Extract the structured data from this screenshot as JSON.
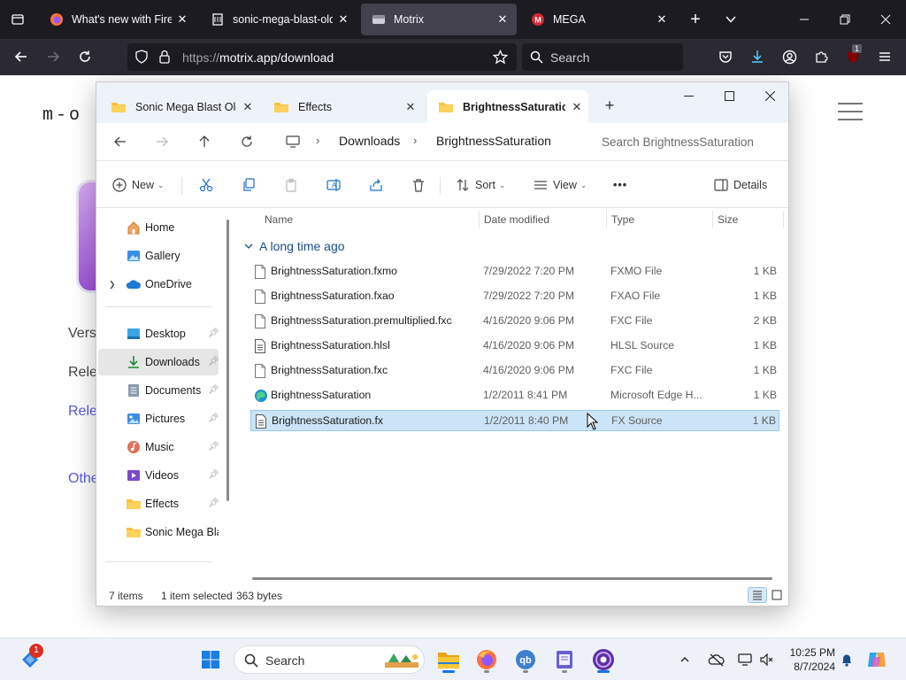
{
  "browser": {
    "tabs": [
      {
        "title": "What's new with Firefo",
        "icon": "firefox-icon"
      },
      {
        "title": "sonic-mega-blast-old-",
        "icon": "github-icon"
      },
      {
        "title": "Motrix",
        "icon": "motrix-icon",
        "active": true
      },
      {
        "title": "MEGA",
        "icon": "mega-icon"
      }
    ],
    "url_scheme": "https://",
    "url_rest": "motrix.app/download",
    "search_placeholder": "Search",
    "extension_badge": "1"
  },
  "page": {
    "logo": "m-o",
    "line1": "Versi",
    "line2": "Rele",
    "line3": "Rele",
    "line4": "Othe"
  },
  "explorer": {
    "tabs": [
      {
        "title": "Sonic Mega Blast Old"
      },
      {
        "title": "Effects"
      },
      {
        "title": "BrightnessSaturation",
        "active": true
      }
    ],
    "breadcrumb": [
      "Downloads",
      "BrightnessSaturation"
    ],
    "search_placeholder": "Search BrightnessSaturation",
    "commands": {
      "new": "New",
      "sort": "Sort",
      "view": "View",
      "more": "•••",
      "details": "Details"
    },
    "nav": [
      {
        "label": "Home",
        "icon": "home-icon"
      },
      {
        "label": "Gallery",
        "icon": "gallery-icon"
      },
      {
        "label": "OneDrive",
        "icon": "onedrive-icon"
      },
      {
        "label": "Desktop",
        "icon": "desktop-icon"
      },
      {
        "label": "Downloads",
        "icon": "downloads-icon"
      },
      {
        "label": "Documents",
        "icon": "documents-icon"
      },
      {
        "label": "Pictures",
        "icon": "pictures-icon"
      },
      {
        "label": "Music",
        "icon": "music-icon"
      },
      {
        "label": "Videos",
        "icon": "videos-icon"
      },
      {
        "label": "Effects",
        "icon": "folder-icon"
      },
      {
        "label": "Sonic Mega Blas",
        "icon": "folder-icon"
      }
    ],
    "columns": {
      "name": "Name",
      "date": "Date modified",
      "type": "Type",
      "size": "Size"
    },
    "group_header": "A long time ago",
    "files": [
      {
        "name": "BrightnessSaturation.fxmo",
        "date": "7/29/2022 7:20 PM",
        "type": "FXMO File",
        "size": "1 KB",
        "icon": "file-icon"
      },
      {
        "name": "BrightnessSaturation.fxao",
        "date": "7/29/2022 7:20 PM",
        "type": "FXAO File",
        "size": "1 KB",
        "icon": "file-icon"
      },
      {
        "name": "BrightnessSaturation.premultiplied.fxc",
        "date": "4/16/2020 9:06 PM",
        "type": "FXC File",
        "size": "2 KB",
        "icon": "file-icon"
      },
      {
        "name": "BrightnessSaturation.hlsl",
        "date": "4/16/2020 9:06 PM",
        "type": "HLSL Source",
        "size": "1 KB",
        "icon": "source-file-icon"
      },
      {
        "name": "BrightnessSaturation.fxc",
        "date": "4/16/2020 9:06 PM",
        "type": "FXC File",
        "size": "1 KB",
        "icon": "file-icon"
      },
      {
        "name": "BrightnessSaturation",
        "date": "1/2/2011 8:41 PM",
        "type": "Microsoft Edge H...",
        "size": "1 KB",
        "icon": "edge-icon"
      },
      {
        "name": "BrightnessSaturation.fx",
        "date": "1/2/2011 8:40 PM",
        "type": "FX Source",
        "size": "1 KB",
        "icon": "source-file-icon",
        "selected": true
      }
    ],
    "status": {
      "items": "7 items",
      "selected": "1 item selected",
      "bytes": "363 bytes"
    }
  },
  "taskbar": {
    "search_placeholder": "Search",
    "widgets_badge": "1",
    "time": "10:25 PM",
    "date": "8/7/2024"
  },
  "colors": {
    "firefox_tabbar": "#1c1b22",
    "firefox_toolbar": "#2b2a33",
    "selection": "#cce4f7",
    "accent": "#1a73e8"
  }
}
